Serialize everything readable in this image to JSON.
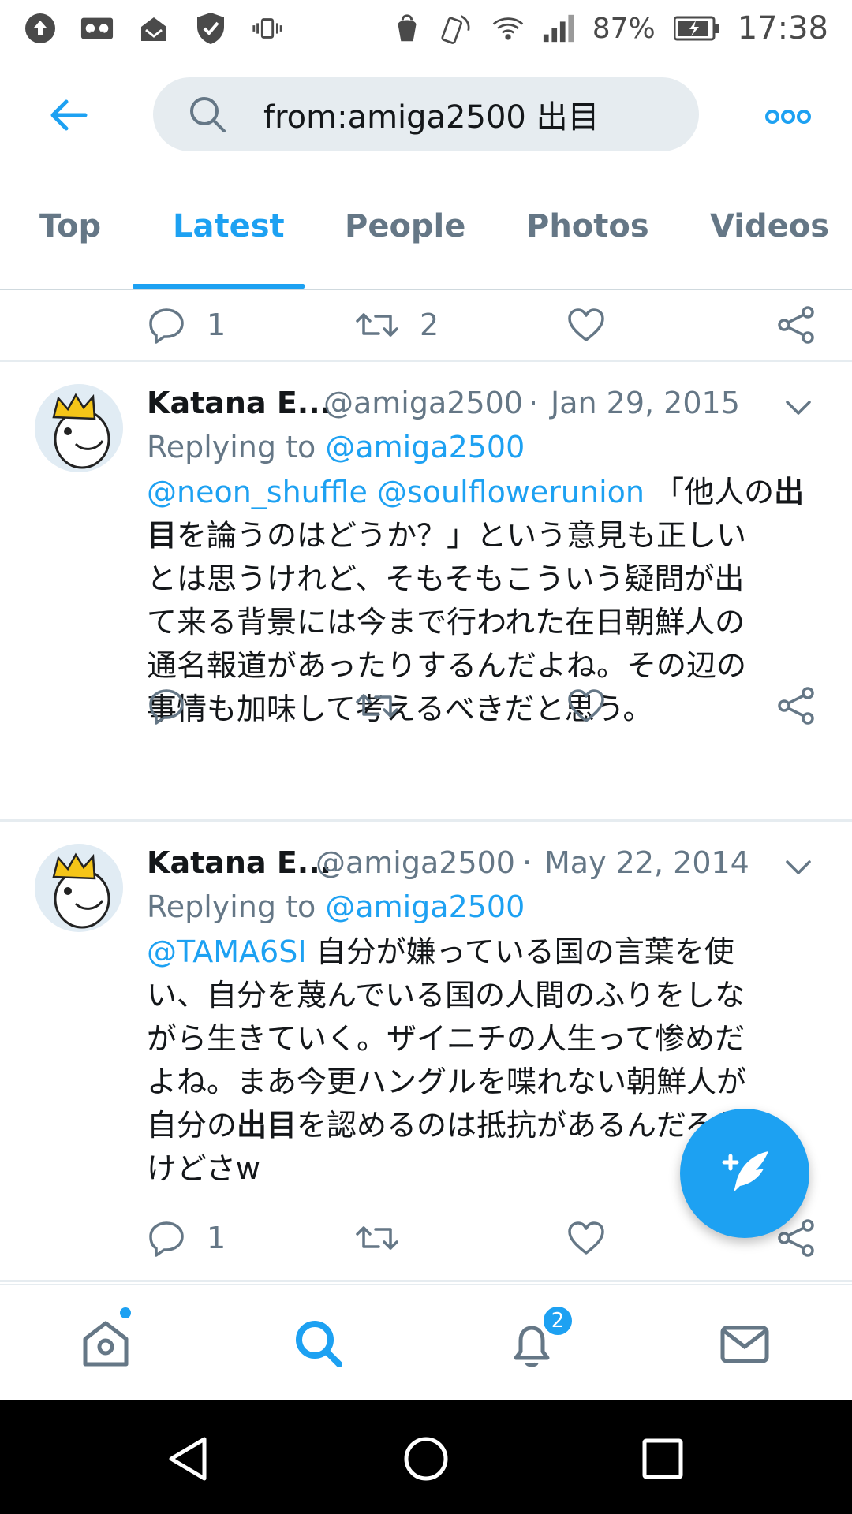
{
  "status_bar": {
    "battery": "87%",
    "time": "17:38",
    "icons": [
      "upload-icon",
      "voicemail-icon",
      "inbox-icon",
      "shield-icon",
      "vibrate-icon",
      "hand-icon",
      "nfc-icon",
      "wifi-icon",
      "signal-icon",
      "battery-icon"
    ]
  },
  "header": {
    "search_query": "from:amiga2500 出目"
  },
  "tabs": [
    {
      "label": "Top",
      "active": false
    },
    {
      "label": "Latest",
      "active": true
    },
    {
      "label": "People",
      "active": false
    },
    {
      "label": "Photos",
      "active": false
    },
    {
      "label": "Videos",
      "active": false
    }
  ],
  "top_partial": {
    "reply_count": "1",
    "retweet_count": "2"
  },
  "tweets": [
    {
      "name": "Katana E...",
      "handle": "@amiga2500",
      "sep": "·",
      "date": "Jan 29, 2015",
      "replying_prefix": "Replying to ",
      "replying_to": "@amiga2500",
      "mentions": "@neon_shuffle @soulflowerunion",
      "line1_rest": " 「他人の",
      "bold1": "出",
      "bold1b": "目",
      "line2_rest": "を論うのはどうか？」という意見も正しい",
      "line3": "とは思うけれど、そもそもこういう疑問が出",
      "line4": "て来る背景には今まで行われた在日朝鮮人の",
      "line5": "通名報道があったりするんだよね。その辺の",
      "line6": "事情も加味して考えるべきだと思う。",
      "reply_count": "",
      "retweet_count": ""
    },
    {
      "name": "Katana E...",
      "handle": "@amiga2500",
      "sep": "·",
      "date": "May 22, 2014",
      "replying_prefix": "Replying to ",
      "replying_to": "@amiga2500",
      "mentions": "@TAMA6SI",
      "line1_rest": " 自分が嫌っている国の言葉を使",
      "line2": "い、自分を蔑んでいる国の人間のふりをしな",
      "line3": "がら生きていく。ザイニチの人生って惨めだ",
      "line4": "よね。まあ今更ハングルを喋れない朝鮮人が",
      "line5_pre": "自分の",
      "bold": "出目",
      "line5_rest": "を認めるのは抵抗があるんだろう",
      "line6": "けどさw",
      "reply_count": "1",
      "retweet_count": ""
    }
  ],
  "bottom_nav": {
    "notification_badge": "2",
    "items": [
      "home-icon",
      "search-icon",
      "bell-icon",
      "mail-icon"
    ]
  },
  "colors": {
    "accent": "#1da1f2",
    "muted": "#657786",
    "text": "#14171a"
  }
}
